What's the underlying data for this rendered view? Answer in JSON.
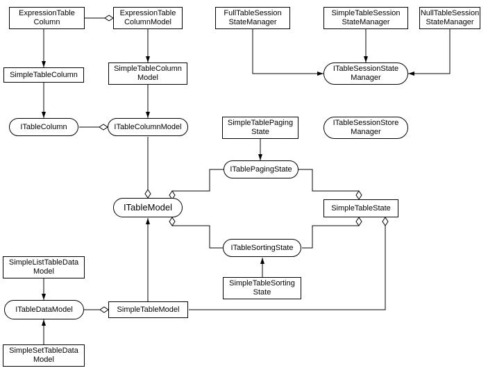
{
  "nodes": {
    "expressionTableColumn": "ExpressionTable\nColumn",
    "expressionTableColumnModel": "ExpressionTable\nColumnModel",
    "fullTableSessionStateManager": "FullTableSession\nStateManager",
    "simpleTableSessionStateManager": "SimpleTableSession\nStateManager",
    "nullTableSessionStateManager": "NullTableSession\nStateManager",
    "simpleTableColumn": "SimpleTableColumn",
    "simpleTableColumnModel": "SimpleTableColumn\nModel",
    "iTableSessionStateManager": "ITableSessionState\nManager",
    "iTableColumn": "ITableColumn",
    "iTableColumnModel": "ITableColumnModel",
    "simpleTablePagingState": "SimpleTablePaging\nState",
    "iTableSessionStoreManager": "ITableSessionStore\nManager",
    "iTablePagingState": "ITablePagingState",
    "iTableModel": "ITableModel",
    "simpleTableState": "SimpleTableState",
    "iTableSortingState": "ITableSortingState",
    "simpleTableSortingState": "SimpleTableSorting\nState",
    "simpleListTableDataModel": "SimpleListTableData\nModel",
    "iTableDataModel": "ITableDataModel",
    "simpleTableModel": "SimpleTableModel",
    "simpleSetTableDataModel": "SimpleSetTableData\nModel"
  },
  "edges": [
    {
      "from": "expressionTableColumn",
      "to": "expressionTableColumnModel",
      "type": "aggregation",
      "note": "diamond at model side"
    },
    {
      "from": "expressionTableColumn",
      "to": "simpleTableColumn",
      "type": "arrow"
    },
    {
      "from": "expressionTableColumnModel",
      "to": "simpleTableColumnModel",
      "type": "arrow"
    },
    {
      "from": "simpleTableColumn",
      "to": "iTableColumn",
      "type": "arrow"
    },
    {
      "from": "simpleTableColumnModel",
      "to": "iTableColumnModel",
      "type": "arrow"
    },
    {
      "from": "iTableColumn",
      "to": "iTableColumnModel",
      "type": "aggregation"
    },
    {
      "from": "fullTableSessionStateManager",
      "to": "iTableSessionStateManager",
      "type": "arrow"
    },
    {
      "from": "simpleTableSessionStateManager",
      "to": "iTableSessionStateManager",
      "type": "arrow"
    },
    {
      "from": "nullTableSessionStateManager",
      "to": "iTableSessionStateManager",
      "type": "arrow"
    },
    {
      "from": "simpleTablePagingState",
      "to": "iTablePagingState",
      "type": "arrow"
    },
    {
      "from": "iTableColumnModel",
      "to": "iTableModel",
      "type": "aggregation",
      "note": "diamond at ITableModel"
    },
    {
      "from": "iTablePagingState",
      "to": "iTableModel",
      "type": "aggregation"
    },
    {
      "from": "iTablePagingState",
      "to": "simpleTableState",
      "type": "aggregation"
    },
    {
      "from": "iTableSortingState",
      "to": "iTableModel",
      "type": "aggregation"
    },
    {
      "from": "iTableSortingState",
      "to": "simpleTableState",
      "type": "aggregation"
    },
    {
      "from": "simpleTableSortingState",
      "to": "iTableSortingState",
      "type": "arrow"
    },
    {
      "from": "simpleListTableDataModel",
      "to": "iTableDataModel",
      "type": "arrow"
    },
    {
      "from": "simpleSetTableDataModel",
      "to": "iTableDataModel",
      "type": "arrow"
    },
    {
      "from": "iTableDataModel",
      "to": "simpleTableModel",
      "type": "aggregation"
    },
    {
      "from": "simpleTableModel",
      "to": "iTableModel",
      "type": "arrow"
    },
    {
      "from": "simpleTableModel",
      "to": "simpleTableState",
      "type": "aggregation"
    }
  ]
}
